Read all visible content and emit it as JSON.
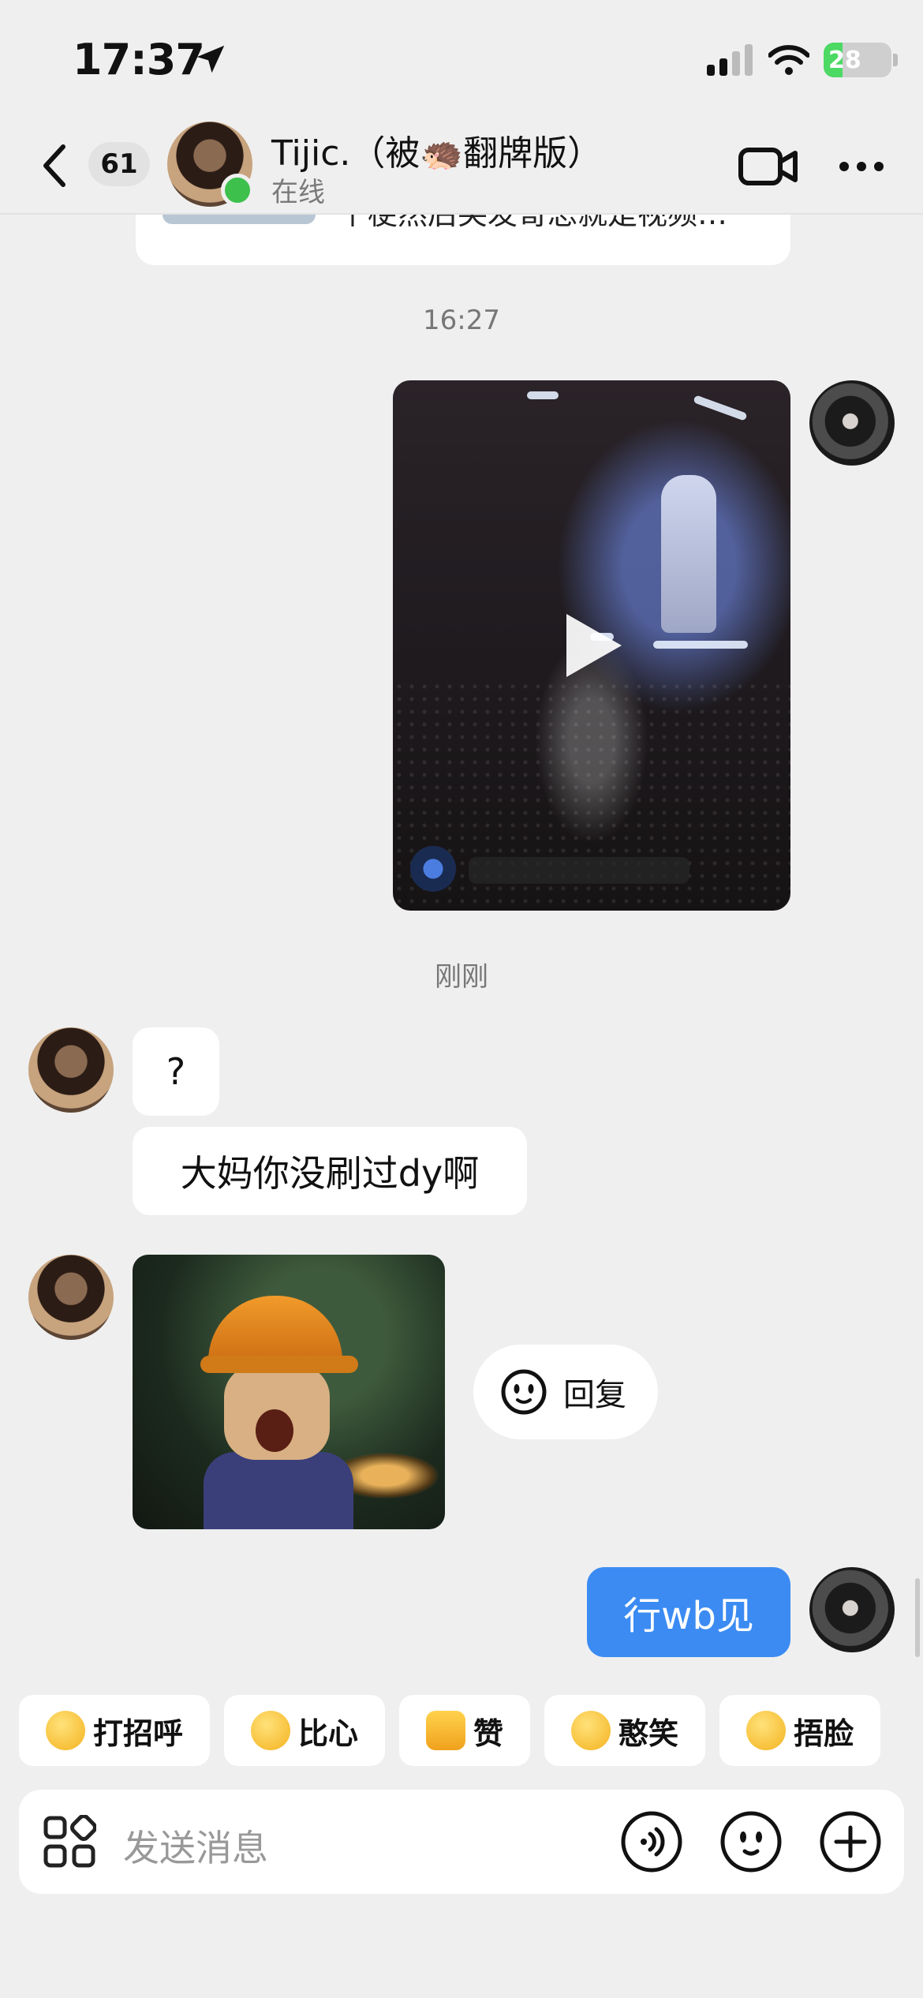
{
  "status_bar": {
    "time": "17:37",
    "battery": "28"
  },
  "header": {
    "unread_count": "61",
    "contact_name": "Tijic.（被🦔翻牌版）",
    "contact_status": "在线"
  },
  "previous_card": {
    "text": "个梗然后笑发哥总就是视频…"
  },
  "messages": {
    "time_1": "16:27",
    "time_2": "刚刚",
    "incoming_1": "?",
    "incoming_2": "大妈你没刷过dy啊",
    "outgoing_1": "行wb见",
    "reply_label": "回复"
  },
  "quick_replies": [
    {
      "label": "打招呼",
      "icon": "waving-emoji-icon"
    },
    {
      "label": "比心",
      "icon": "heart-hands-emoji-icon"
    },
    {
      "label": "赞",
      "icon": "thumbs-up-emoji-icon"
    },
    {
      "label": "憨笑",
      "icon": "grin-emoji-icon"
    },
    {
      "label": "捂脸",
      "icon": "facepalm-emoji-icon"
    }
  ],
  "input": {
    "placeholder": "发送消息"
  },
  "colors": {
    "background": "#efefef",
    "accent_blue": "#3b8bf3",
    "online_green": "#3ec04d"
  }
}
